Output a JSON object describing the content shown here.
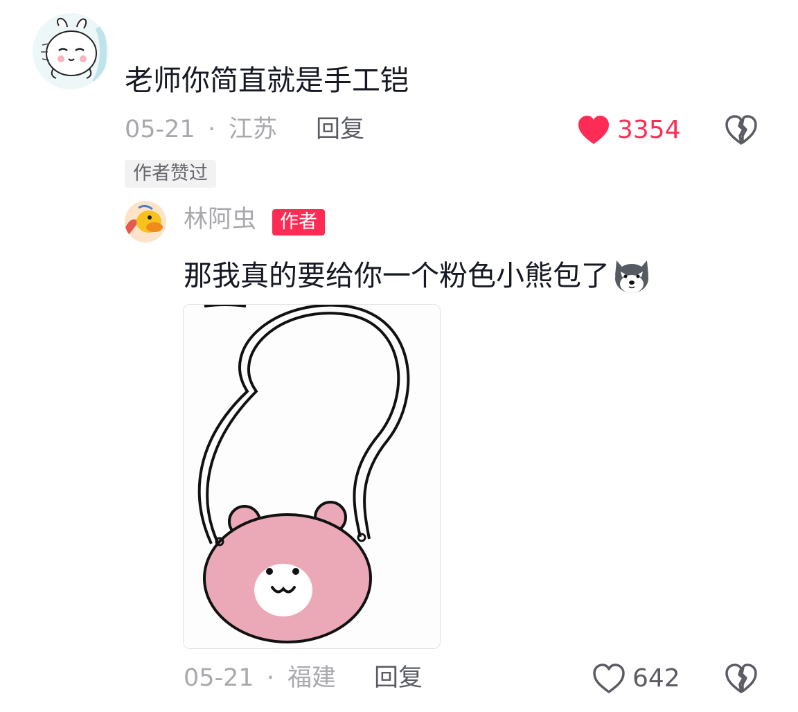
{
  "comment": {
    "text": "老师你简直就是手工铠",
    "date": "05-21",
    "separator": "·",
    "location": "江苏",
    "reply_label": "回复",
    "like_count": "3354",
    "liked": true,
    "author_liked_badge": "作者赞过",
    "avatar_icon": "bunny-avatar-icon"
  },
  "reply": {
    "author_name": "林阿虫",
    "author_badge": "作者",
    "text": "那我真的要给你一个粉色小熊包了",
    "emoji_icon": "husky-emoji-icon",
    "image_icon": "pink-bear-bag-image",
    "date": "05-21",
    "separator": "·",
    "location": "福建",
    "reply_label": "回复",
    "like_count": "642",
    "liked": false,
    "avatar_icon": "duck-avatar-icon"
  },
  "colors": {
    "like_active": "#fe2c55",
    "text_primary": "#161823",
    "text_secondary": "#a9a9ad",
    "badge_bg": "#fe2c55"
  }
}
